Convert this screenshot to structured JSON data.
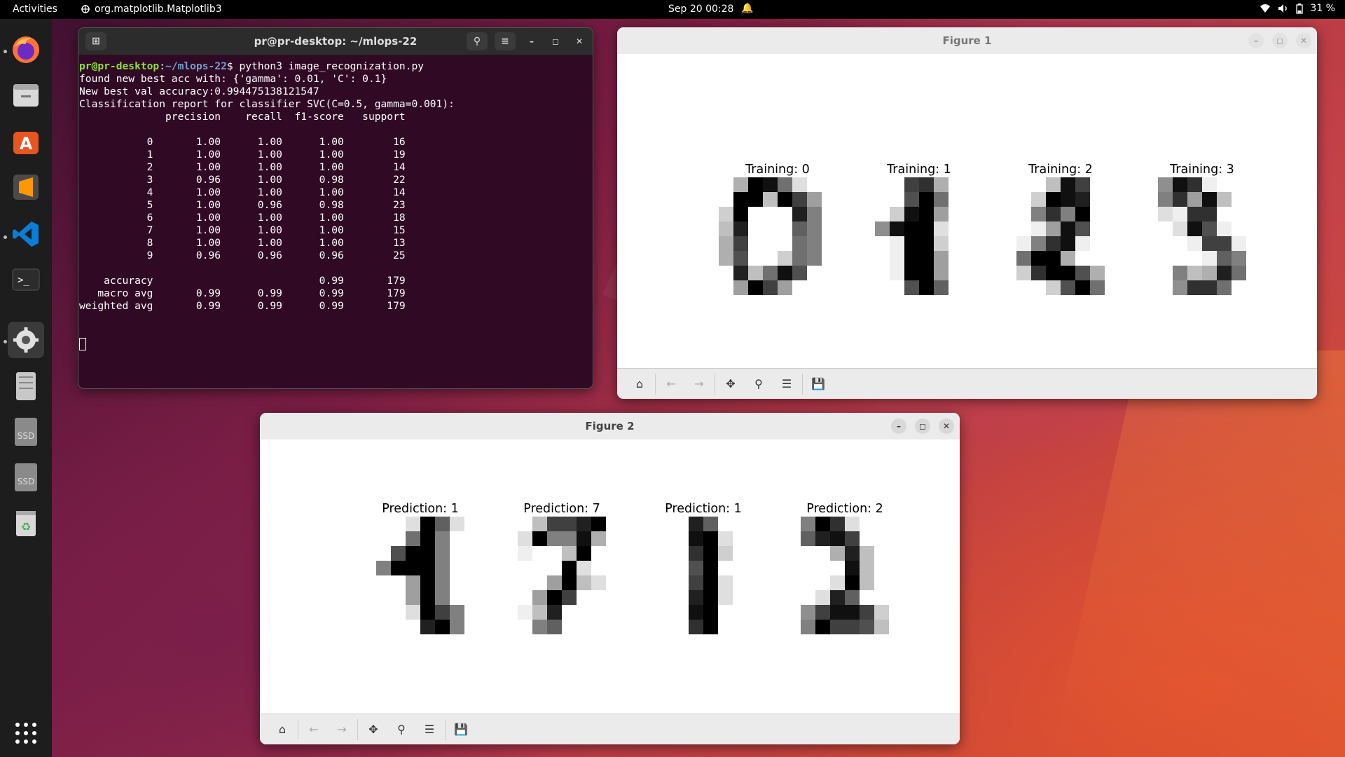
{
  "topbar": {
    "activities": "Activities",
    "app_name": "org.matplotlib.Matplotlib3",
    "clock": "Sep 20  00:28",
    "battery": "31 %"
  },
  "dock": {
    "items": [
      "firefox-icon",
      "files-icon",
      "app-center-icon",
      "sublime-text-icon",
      "vscode-icon",
      "terminal-icon",
      "settings-icon",
      "disks-icon",
      "ssd-drive-icon",
      "ssd-drive-icon",
      "trash-icon",
      "show-apps-icon"
    ],
    "ssd_label": "SSD"
  },
  "terminal": {
    "title": "pr@pr-desktop: ~/mlops-22",
    "prompt_user": "pr@pr-desktop",
    "prompt_path": "~/mlops-22",
    "command": "$ python3 image_recognization.py",
    "lines": [
      "found new best acc with: {'gamma': 0.01, 'C': 0.1}",
      "New best val accuracy:0.994475138121547",
      "Classification report for classifier SVC(C=0.5, gamma=0.001):",
      "              precision    recall  f1-score   support",
      "",
      "           0       1.00      1.00      1.00        16",
      "           1       1.00      1.00      1.00        19",
      "           2       1.00      1.00      1.00        14",
      "           3       0.96      1.00      0.98        22",
      "           4       1.00      1.00      1.00        14",
      "           5       1.00      0.96      0.98        23",
      "           6       1.00      1.00      1.00        18",
      "           7       1.00      1.00      1.00        15",
      "           8       1.00      1.00      1.00        13",
      "           9       0.96      0.96      0.96        25",
      "",
      "    accuracy                           0.99       179",
      "   macro avg       0.99      0.99      0.99       179",
      "weighted avg       0.99      0.99      0.99       179"
    ]
  },
  "figure1": {
    "title": "Figure 1",
    "panels": [
      {
        "title": "Training: 0",
        "pixels": [
          [
            0,
            5,
            16,
            15,
            9,
            2,
            0,
            0
          ],
          [
            0,
            16,
            16,
            4,
            16,
            12,
            6,
            0
          ],
          [
            3,
            16,
            0,
            0,
            0,
            14,
            8,
            0
          ],
          [
            4,
            14,
            0,
            0,
            0,
            10,
            8,
            0
          ],
          [
            5,
            12,
            0,
            0,
            0,
            9,
            8,
            0
          ],
          [
            5,
            11,
            0,
            0,
            3,
            9,
            8,
            0
          ],
          [
            0,
            14,
            4,
            9,
            15,
            11,
            0,
            0
          ],
          [
            0,
            6,
            16,
            12,
            6,
            0,
            0,
            0
          ]
        ]
      },
      {
        "title": "Training: 1",
        "pixels": [
          [
            0,
            0,
            0,
            12,
            13,
            5,
            0,
            0
          ],
          [
            0,
            0,
            0,
            11,
            16,
            9,
            0,
            0
          ],
          [
            0,
            0,
            3,
            15,
            16,
            6,
            0,
            0
          ],
          [
            0,
            7,
            15,
            16,
            16,
            2,
            0,
            0
          ],
          [
            0,
            0,
            1,
            16,
            16,
            3,
            0,
            0
          ],
          [
            0,
            0,
            1,
            16,
            16,
            6,
            0,
            0
          ],
          [
            0,
            0,
            1,
            16,
            16,
            6,
            0,
            0
          ],
          [
            0,
            0,
            0,
            11,
            16,
            10,
            0,
            0
          ]
        ]
      },
      {
        "title": "Training: 2",
        "pixels": [
          [
            0,
            0,
            0,
            4,
            15,
            12,
            0,
            0
          ],
          [
            0,
            0,
            3,
            16,
            15,
            14,
            0,
            0
          ],
          [
            0,
            0,
            8,
            13,
            8,
            16,
            0,
            0
          ],
          [
            0,
            0,
            1,
            6,
            15,
            11,
            0,
            0
          ],
          [
            0,
            1,
            8,
            13,
            15,
            1,
            0,
            0
          ],
          [
            0,
            9,
            16,
            16,
            5,
            0,
            0,
            0
          ],
          [
            0,
            3,
            13,
            16,
            16,
            11,
            5,
            0
          ],
          [
            0,
            0,
            0,
            3,
            11,
            16,
            9,
            0
          ]
        ]
      },
      {
        "title": "Training: 3",
        "pixels": [
          [
            0,
            7,
            15,
            13,
            1,
            0,
            0,
            0
          ],
          [
            0,
            8,
            13,
            6,
            15,
            4,
            0,
            0
          ],
          [
            0,
            2,
            1,
            13,
            13,
            0,
            0,
            0
          ],
          [
            0,
            0,
            2,
            15,
            11,
            1,
            0,
            0
          ],
          [
            0,
            0,
            0,
            1,
            12,
            12,
            1,
            0
          ],
          [
            0,
            0,
            0,
            0,
            1,
            10,
            8,
            0
          ],
          [
            0,
            0,
            8,
            4,
            5,
            14,
            9,
            0
          ],
          [
            0,
            0,
            7,
            13,
            13,
            9,
            0,
            0
          ]
        ]
      }
    ]
  },
  "figure2": {
    "title": "Figure 2",
    "panels": [
      {
        "title": "Prediction: 1",
        "pixels": [
          [
            0,
            0,
            0,
            2,
            16,
            10,
            2,
            0
          ],
          [
            0,
            0,
            0,
            9,
            16,
            8,
            0,
            0
          ],
          [
            0,
            0,
            11,
            16,
            16,
            8,
            0,
            0
          ],
          [
            0,
            8,
            16,
            16,
            16,
            8,
            0,
            0
          ],
          [
            0,
            0,
            0,
            6,
            16,
            8,
            0,
            0
          ],
          [
            0,
            0,
            0,
            6,
            16,
            8,
            0,
            0
          ],
          [
            0,
            0,
            0,
            2,
            16,
            12,
            8,
            0
          ],
          [
            0,
            0,
            0,
            0,
            14,
            16,
            8,
            0
          ]
        ]
      },
      {
        "title": "Prediction: 7",
        "pixels": [
          [
            0,
            0,
            4,
            12,
            12,
            14,
            16,
            0
          ],
          [
            0,
            2,
            16,
            8,
            8,
            15,
            5,
            0
          ],
          [
            0,
            1,
            0,
            0,
            4,
            16,
            0,
            0
          ],
          [
            0,
            0,
            0,
            0,
            16,
            2,
            0,
            0
          ],
          [
            0,
            0,
            0,
            6,
            16,
            4,
            2,
            0
          ],
          [
            0,
            0,
            6,
            16,
            12,
            0,
            0,
            0
          ],
          [
            0,
            1,
            4,
            14,
            0,
            0,
            0,
            0
          ],
          [
            0,
            0,
            8,
            10,
            0,
            0,
            0,
            0
          ]
        ]
      },
      {
        "title": "Prediction: 1",
        "pixels": [
          [
            0,
            0,
            0,
            14,
            10,
            0,
            0,
            0
          ],
          [
            0,
            0,
            0,
            15,
            16,
            2,
            0,
            0
          ],
          [
            0,
            0,
            0,
            13,
            16,
            3,
            0,
            0
          ],
          [
            0,
            0,
            0,
            11,
            16,
            0,
            0,
            0
          ],
          [
            0,
            0,
            0,
            12,
            16,
            2,
            0,
            0
          ],
          [
            0,
            0,
            0,
            14,
            16,
            2,
            0,
            0
          ],
          [
            0,
            0,
            0,
            15,
            16,
            0,
            0,
            0
          ],
          [
            0,
            0,
            0,
            13,
            16,
            0,
            0,
            0
          ]
        ]
      },
      {
        "title": "Prediction: 2",
        "pixels": [
          [
            0,
            8,
            16,
            13,
            2,
            0,
            0,
            0
          ],
          [
            0,
            10,
            14,
            15,
            12,
            0,
            0,
            0
          ],
          [
            0,
            0,
            0,
            5,
            14,
            4,
            0,
            0
          ],
          [
            0,
            0,
            0,
            0,
            15,
            4,
            0,
            0
          ],
          [
            0,
            0,
            0,
            2,
            16,
            4,
            0,
            0
          ],
          [
            0,
            0,
            2,
            14,
            10,
            0,
            0,
            0
          ],
          [
            0,
            7,
            12,
            15,
            15,
            12,
            3,
            0
          ],
          [
            0,
            8,
            16,
            12,
            12,
            11,
            4,
            0
          ]
        ]
      }
    ]
  }
}
